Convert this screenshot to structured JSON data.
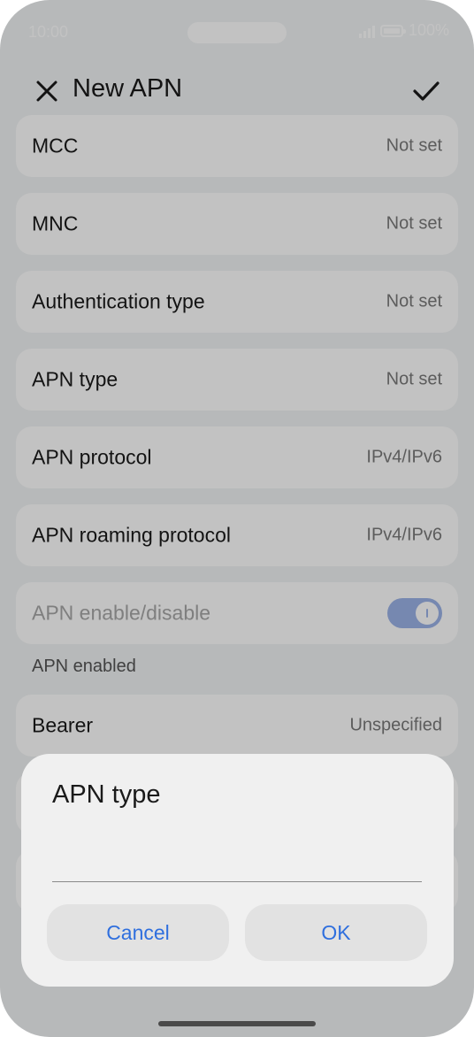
{
  "status_bar": {
    "time": "10:00",
    "battery": "100%"
  },
  "header": {
    "title": "New APN",
    "close_icon": "close-icon",
    "confirm_icon": "check-icon"
  },
  "settings": {
    "items": [
      {
        "label": "MCC",
        "value": "Not set"
      },
      {
        "label": "MNC",
        "value": "Not set"
      },
      {
        "label": "Authentication type",
        "value": "Not set"
      },
      {
        "label": "APN type",
        "value": "Not set"
      },
      {
        "label": "APN protocol",
        "value": "IPv4/IPv6"
      },
      {
        "label": "APN roaming protocol",
        "value": "IPv4/IPv6"
      }
    ],
    "toggle_item": {
      "label": "APN enable/disable",
      "enabled": true
    },
    "note": "APN enabled",
    "bearer": {
      "label": "Bearer",
      "value": "Unspecified"
    }
  },
  "dialog": {
    "title": "APN type",
    "input_value": "",
    "cancel_label": "Cancel",
    "ok_label": "OK"
  },
  "colors": {
    "accent": "#2f6fde",
    "toggle_on": "#9cb3e8"
  }
}
